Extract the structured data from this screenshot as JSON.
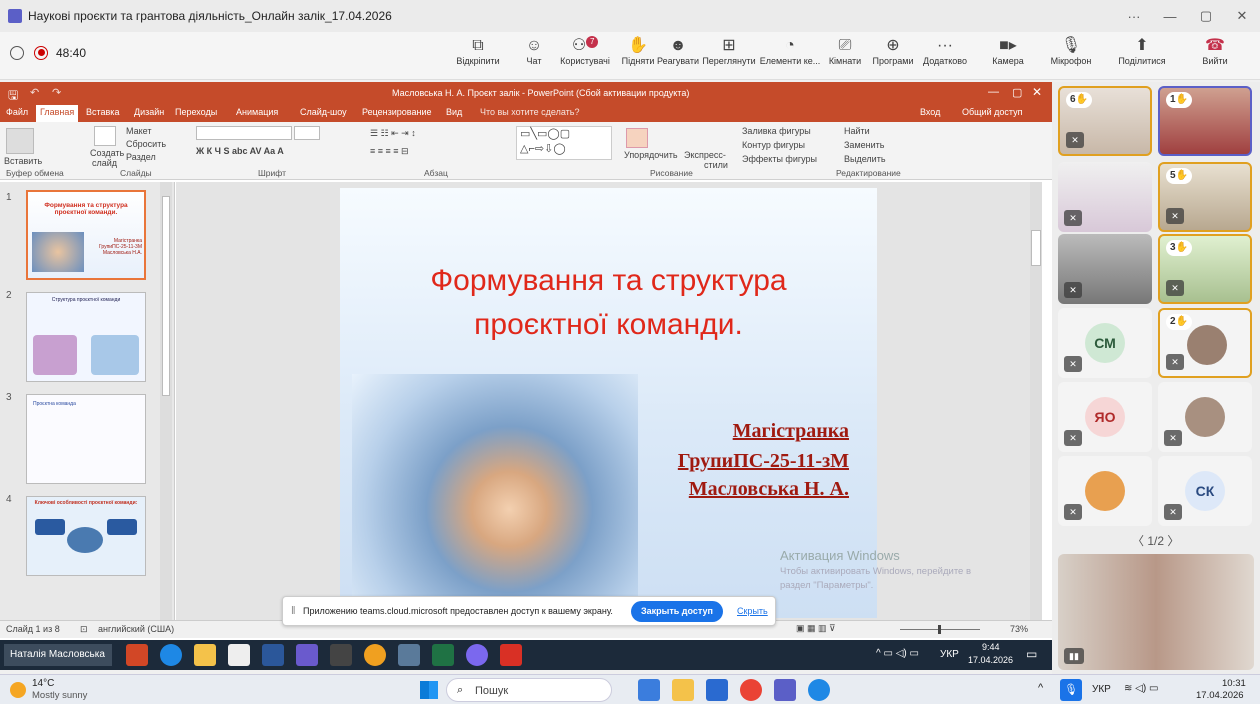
{
  "window": {
    "title": "Наукові проєкти та грантова діяльність_Онлайн залік_17.04.2026",
    "ctl_more": "···",
    "ctl_min": "—",
    "ctl_restore": "▢",
    "ctl_close": "✕"
  },
  "meeting": {
    "timer": "48:40",
    "tools": [
      {
        "icon": "⧉",
        "label": "Відкріпити"
      },
      {
        "icon": "☺",
        "label": "Чат"
      },
      {
        "icon": "⚇",
        "label": "Користувачі",
        "badge": "7"
      },
      {
        "icon": "✋",
        "label": "Підняти"
      },
      {
        "icon": "☻",
        "label": "Реагувати"
      },
      {
        "icon": "⊞",
        "label": "Переглянути"
      },
      {
        "icon": "◔",
        "label": "Елементи ке..."
      },
      {
        "icon": "⎚",
        "label": "Кімнати"
      },
      {
        "icon": "⊕",
        "label": "Програми"
      },
      {
        "icon": "···",
        "label": "Додатково"
      }
    ],
    "camera": "Камера",
    "microphone": "Мікрофон",
    "share": "Поділитися",
    "leave": "Вийти"
  },
  "ppt": {
    "title": "Масловська Н. А. Проєкт залік - PowerPoint (Сбой активации продукта)",
    "signin": "Вход",
    "shared": "Общий доступ",
    "tabs": [
      "Файл",
      "Главная",
      "Вставка",
      "Дизайн",
      "Переходы",
      "Анимация",
      "Слайд-шоу",
      "Рецензирование",
      "Вид",
      "Что вы хотите сделать?"
    ],
    "ribbon": {
      "paste": "Вставить",
      "create": "Создать",
      "slide": "слайд",
      "layout": "Макет",
      "reset": "Сбросить",
      "section": "Раздел",
      "arrange": "Упорядочить",
      "quick": "Экспресс-",
      "styles": "стили",
      "fill": "Заливка фигуры",
      "outline": "Контур фигуры",
      "effects": "Эффекты фигуры",
      "find": "Найти",
      "replace": "Заменить",
      "select": "Выделить",
      "groups": [
        "Буфер обмена",
        "Слайды",
        "Шрифт",
        "Абзац",
        "Рисование",
        "Редактирование"
      ]
    },
    "thumbs": [
      {
        "n": "1",
        "title": "Формування та структура проєктної команди.",
        "sub": "Магістранка ГрупиПС-25-11-3М Масловська Н.А."
      },
      {
        "n": "2",
        "title": "Структура проєктної команди"
      },
      {
        "n": "3",
        "title": "Проєктна команда"
      },
      {
        "n": "4",
        "title": "Ключові особливості проєктної команди:"
      }
    ],
    "slide": {
      "title1": "Формування та структура",
      "title2": "проєктної команди.",
      "author1": "Магістранка",
      "author2": "ГрупиПС-25-11-зМ",
      "author3": "Масловська Н. А."
    },
    "activation": {
      "line1": "Активация Windows",
      "line2": "Чтобы активировать Windows, перейдите в",
      "line3": "раздел \"Параметры\"."
    },
    "status": {
      "slide": "Слайд 1 из 8",
      "lang": "английский (США)",
      "zoom": "73%"
    },
    "share_bar": {
      "text": "Приложению teams.cloud.microsoft предоставлен доступ к вашему экрану.",
      "close": "Закрыть доступ",
      "hide": "Скрыть"
    },
    "taskbar": {
      "user": "Наталія Масловська",
      "lang": "УКР",
      "time": "9:44",
      "date": "17.04.2026"
    }
  },
  "participants": {
    "hands": [
      "6",
      "1",
      "5",
      "3",
      "2"
    ],
    "initials": [
      "СМ",
      "ЯО",
      "СК"
    ],
    "pager": "1/2"
  },
  "wintaskbar": {
    "temp": "14°C",
    "weather": "Mostly sunny",
    "search": "Пошук",
    "lang": "УКР",
    "time": "10:31",
    "date": "17.04.2026"
  },
  "colors": {
    "ppt": "#c54b2a",
    "slide_title": "#e0281a",
    "author": "#a01a10",
    "hand": "#e0a020"
  }
}
